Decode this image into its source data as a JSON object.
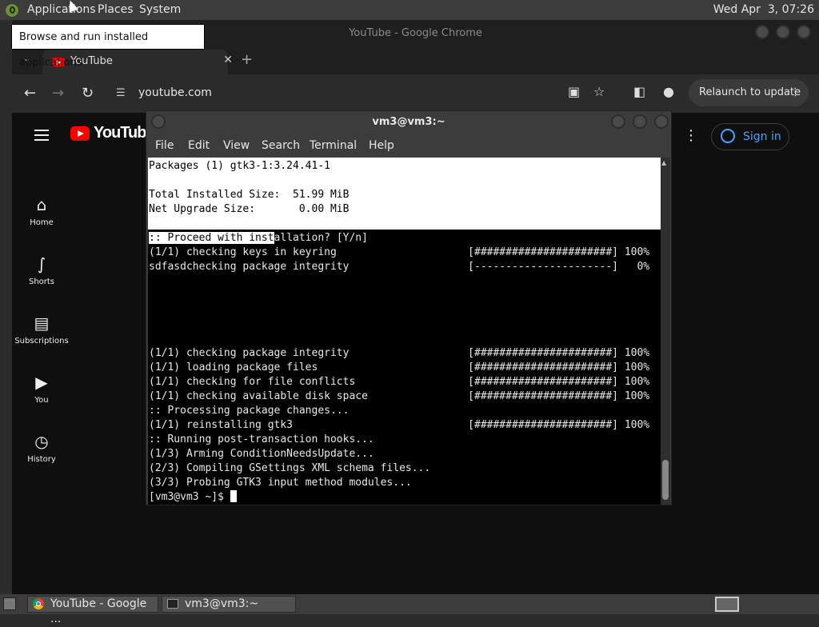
{
  "top_panel": {
    "menus": [
      "Applications",
      "Places",
      "System"
    ],
    "clock": "Wed Apr  3, 07:26"
  },
  "tooltip": "Browse and run installed applications",
  "chrome": {
    "window_title": "YouTube - Google Chrome",
    "tab_title": "YouTube",
    "url": "youtube.com",
    "relaunch_label": "Relaunch to update"
  },
  "youtube": {
    "logo_text": "YouTube",
    "sidebar": [
      {
        "label": "Home",
        "icon": "home-icon"
      },
      {
        "label": "Shorts",
        "icon": "shorts-icon"
      },
      {
        "label": "Subscriptions",
        "icon": "subscriptions-icon"
      },
      {
        "label": "You",
        "icon": "you-icon"
      },
      {
        "label": "History",
        "icon": "history-icon"
      }
    ],
    "sign_in": "Sign in"
  },
  "terminal": {
    "title": "vm3@vm3:~",
    "menu": [
      "File",
      "Edit",
      "View",
      "Search",
      "Terminal",
      "Help"
    ],
    "selected_lines": [
      "Packages (1) gtk3-1:3.24.41-1",
      "",
      "Total Installed Size:  51.99 MiB",
      "Net Upgrade Size:       0.00 MiB",
      ""
    ],
    "proceed_selected": ":: Proceed with inst",
    "proceed_rest": "allation? [Y/n]",
    "lines": [
      "(1/1) checking keys in keyring                     [######################] 100%",
      "sdfasdchecking package integrity                   [----------------------]   0%",
      "",
      "",
      "",
      "",
      "",
      "(1/1) checking package integrity                   [######################] 100%",
      "(1/1) loading package files                        [######################] 100%",
      "(1/1) checking for file conflicts                  [######################] 100%",
      "(1/1) checking available disk space                [######################] 100%",
      ":: Processing package changes...",
      "(1/1) reinstalling gtk3                            [######################] 100%",
      ":: Running post-transaction hooks...",
      "(1/3) Arming ConditionNeedsUpdate...",
      "(2/3) Compiling GSettings XML schema files...",
      "(3/3) Probing GTK3 input method modules..."
    ],
    "prompt": "[vm3@vm3 ~]$ "
  },
  "taskbar": {
    "tasks": [
      "YouTube - Google ...",
      "vm3@vm3:~"
    ]
  }
}
